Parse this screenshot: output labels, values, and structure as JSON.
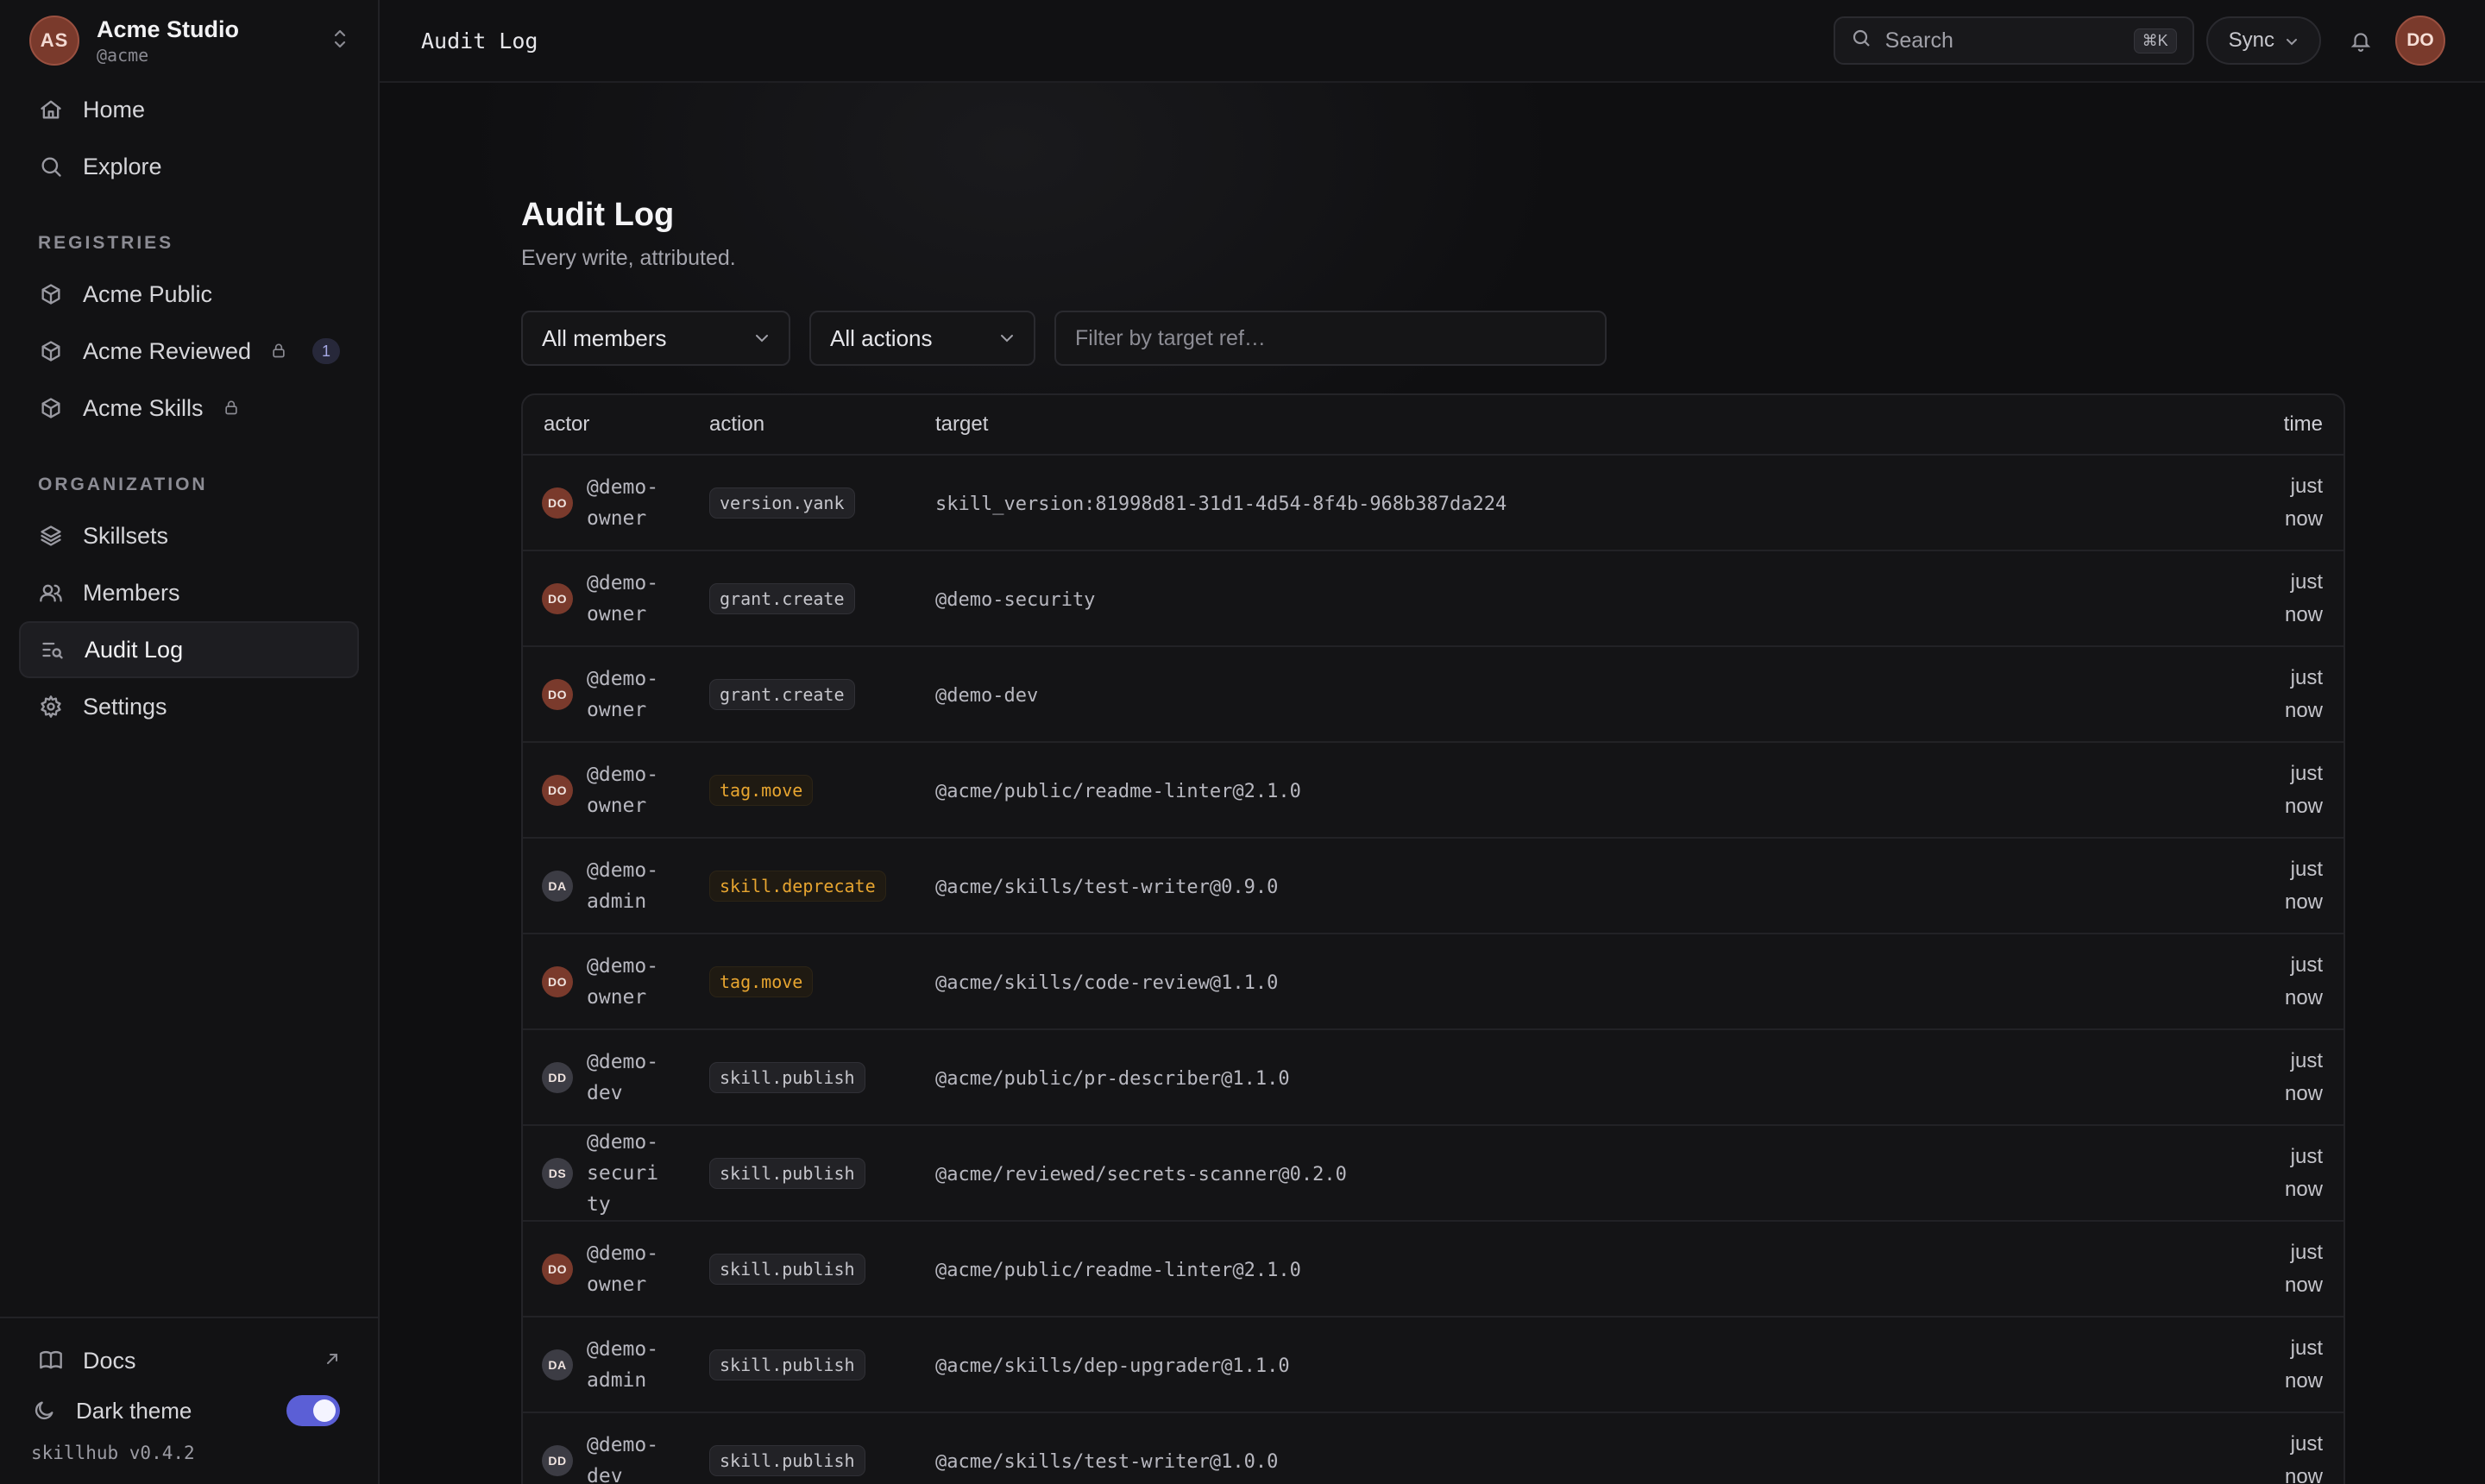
{
  "workspace": {
    "initials": "AS",
    "name": "Acme Studio",
    "handle": "@acme"
  },
  "nav_main": [
    {
      "label": "Home",
      "icon": "home-icon"
    },
    {
      "label": "Explore",
      "icon": "search-icon"
    }
  ],
  "registries": {
    "label": "REGISTRIES",
    "items": [
      {
        "label": "Acme Public"
      },
      {
        "label": "Acme Reviewed",
        "badge": "1"
      },
      {
        "label": "Acme Skills"
      }
    ]
  },
  "organization": {
    "label": "ORGANIZATION",
    "items": [
      {
        "label": "Skillsets"
      },
      {
        "label": "Members"
      },
      {
        "label": "Audit Log"
      },
      {
        "label": "Settings"
      }
    ]
  },
  "sidebar_bottom": {
    "docs": "Docs",
    "dark_theme": "Dark theme",
    "theme_on": true,
    "version": "skillhub v0.4.2"
  },
  "topbar": {
    "title": "Audit Log",
    "search_placeholder": "Search",
    "shortcut": "⌘K",
    "sync_label": "Sync",
    "user_initials": "DO"
  },
  "page": {
    "title": "Audit Log",
    "subtitle": "Every write, attributed.",
    "filter_members": "All members",
    "filter_actions": "All actions",
    "filter_target_placeholder": "Filter by target ref…"
  },
  "table": {
    "headers": {
      "actor": "actor",
      "action": "action",
      "target": "target",
      "time": "time"
    },
    "rows": [
      {
        "initials": "DO",
        "actor": "@demo-owner",
        "action": "version.yank",
        "tone": "neutral",
        "target": "skill_version:81998d81-31d1-4d54-8f4b-968b387da224",
        "time": "just now"
      },
      {
        "initials": "DO",
        "actor": "@demo-owner",
        "action": "grant.create",
        "tone": "neutral",
        "target": "@demo-security",
        "time": "just now"
      },
      {
        "initials": "DO",
        "actor": "@demo-owner",
        "action": "grant.create",
        "tone": "neutral",
        "target": "@demo-dev",
        "time": "just now"
      },
      {
        "initials": "DO",
        "actor": "@demo-owner",
        "action": "tag.move",
        "tone": "warn",
        "target": "@acme/public/readme-linter@2.1.0",
        "time": "just now"
      },
      {
        "initials": "DA",
        "actor": "@demo-admin",
        "action": "skill.deprecate",
        "tone": "warn",
        "target": "@acme/skills/test-writer@0.9.0",
        "time": "just now"
      },
      {
        "initials": "DO",
        "actor": "@demo-owner",
        "action": "tag.move",
        "tone": "warn",
        "target": "@acme/skills/code-review@1.1.0",
        "time": "just now"
      },
      {
        "initials": "DD",
        "actor": "@demo-dev",
        "action": "skill.publish",
        "tone": "neutral",
        "target": "@acme/public/pr-describer@1.1.0",
        "time": "just now"
      },
      {
        "initials": "DS",
        "actor": "@demo-security",
        "action": "skill.publish",
        "tone": "neutral",
        "target": "@acme/reviewed/secrets-scanner@0.2.0",
        "time": "just now"
      },
      {
        "initials": "DO",
        "actor": "@demo-owner",
        "action": "skill.publish",
        "tone": "neutral",
        "target": "@acme/public/readme-linter@2.1.0",
        "time": "just now"
      },
      {
        "initials": "DA",
        "actor": "@demo-admin",
        "action": "skill.publish",
        "tone": "neutral",
        "target": "@acme/skills/dep-upgrader@1.1.0",
        "time": "just now"
      },
      {
        "initials": "DD",
        "actor": "@demo-dev",
        "action": "skill.publish",
        "tone": "neutral",
        "target": "@acme/skills/test-writer@1.0.0",
        "time": "just now"
      }
    ]
  },
  "colors": {
    "accent": "#5b5fd6",
    "warn_text": "#e7a530",
    "avatar_owner": "#7a3a2c",
    "avatar_other": "#3c3c44"
  }
}
